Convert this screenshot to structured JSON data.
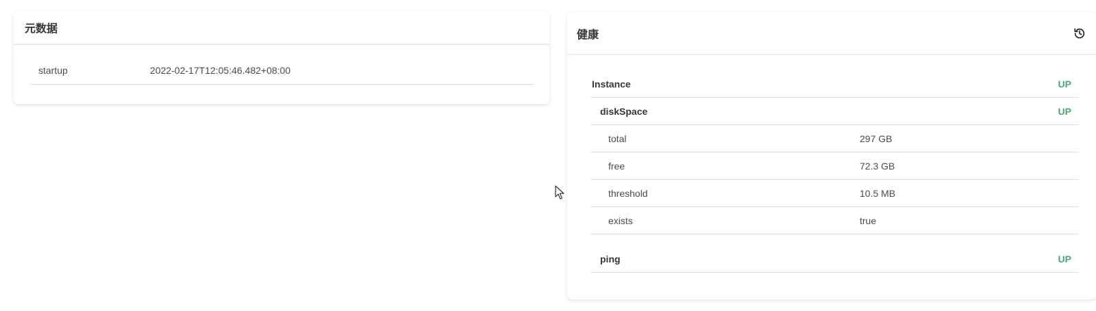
{
  "metadata": {
    "title": "元数据",
    "rows": [
      {
        "key": "startup",
        "value": "2022-02-17T12:05:46.482+08:00"
      }
    ]
  },
  "health": {
    "title": "健康",
    "history_icon": "history-icon",
    "instance": {
      "label": "Instance",
      "status": "UP"
    },
    "diskSpace": {
      "label": "diskSpace",
      "status": "UP",
      "details": [
        {
          "key": "total",
          "value": "297 GB"
        },
        {
          "key": "free",
          "value": "72.3 GB"
        },
        {
          "key": "threshold",
          "value": "10.5 MB"
        },
        {
          "key": "exists",
          "value": "true"
        }
      ]
    },
    "ping": {
      "label": "ping",
      "status": "UP"
    }
  },
  "colors": {
    "status_up": "#48a878",
    "text": "#363636",
    "divider": "#dcdcdc"
  }
}
